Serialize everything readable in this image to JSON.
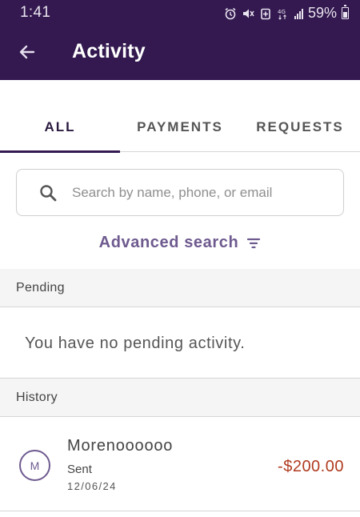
{
  "status_bar": {
    "time": "1:41",
    "battery_percent": "59%",
    "icons": [
      "alarm-icon",
      "mute-icon",
      "battery-saver-icon",
      "data-4g-icon",
      "signal-icon",
      "battery-icon"
    ]
  },
  "header": {
    "title": "Activity",
    "back_icon": "arrow-left-icon"
  },
  "tabs": [
    {
      "label": "ALL",
      "active": true
    },
    {
      "label": "PAYMENTS",
      "active": false
    },
    {
      "label": "REQUESTS",
      "active": false
    }
  ],
  "search": {
    "placeholder": "Search by name, phone, or email",
    "value": ""
  },
  "advanced_search": {
    "label": "Advanced search",
    "icon": "filter-icon"
  },
  "pending": {
    "header": "Pending",
    "empty_message": "You have no pending activity."
  },
  "history": {
    "header": "History",
    "items": [
      {
        "avatar_initial": "M",
        "name": "Morenoooooo",
        "status": "Sent",
        "date": "12/06/24",
        "amount": "-$200.00"
      }
    ]
  },
  "colors": {
    "header_bg": "#33194f",
    "accent": "#6e5a8f",
    "negative_amount": "#b03a1e"
  }
}
